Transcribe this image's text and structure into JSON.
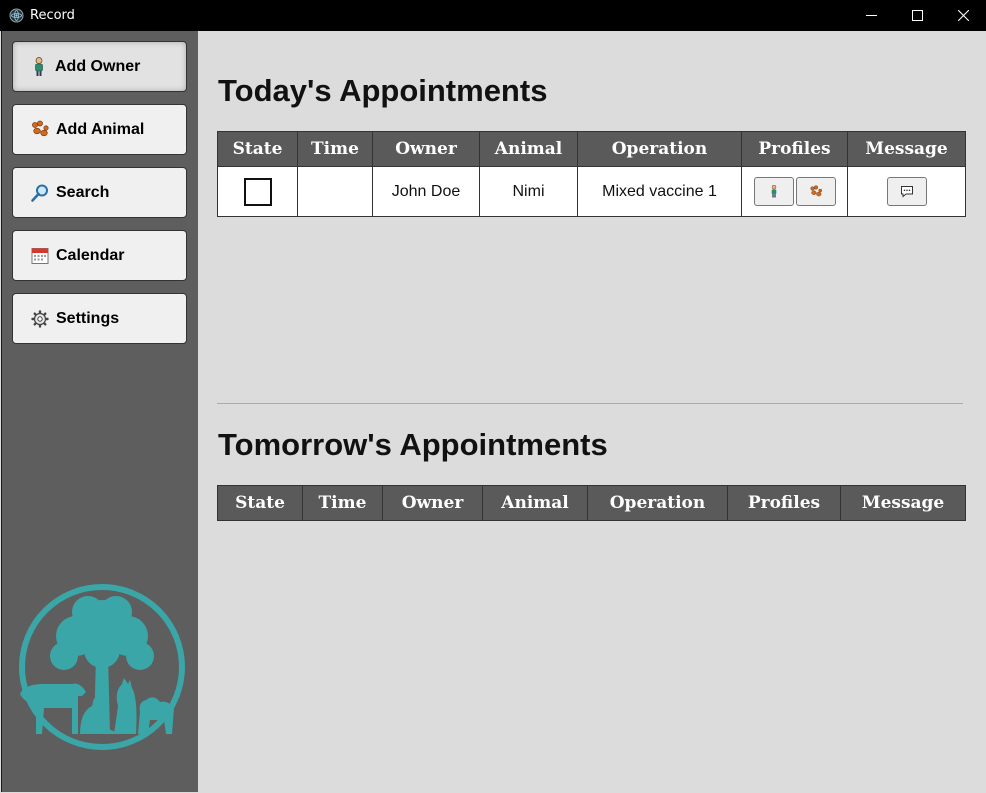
{
  "window": {
    "title": "Record"
  },
  "sidebar": {
    "items": [
      {
        "label": "Add Owner",
        "icon": "person-icon"
      },
      {
        "label": "Add Animal",
        "icon": "paw-icon"
      },
      {
        "label": "Search",
        "icon": "magnifier-icon"
      },
      {
        "label": "Calendar",
        "icon": "calendar-icon"
      },
      {
        "label": "Settings",
        "icon": "gear-icon"
      }
    ]
  },
  "today": {
    "title": "Today's Appointments",
    "headers": [
      "State",
      "Time",
      "Owner",
      "Animal",
      "Operation",
      "Profiles",
      "Message"
    ],
    "rows": [
      {
        "state": "",
        "time": "",
        "owner": "John Doe",
        "animal": "Nimi",
        "operation": "Mixed vaccine 1"
      }
    ]
  },
  "tomorrow": {
    "title": "Tomorrow's Appointments",
    "headers": [
      "State",
      "Time",
      "Owner",
      "Animal",
      "Operation",
      "Profiles",
      "Message"
    ]
  },
  "colors": {
    "accent": "#3aa6a8",
    "sidebar": "#5e5e5e",
    "header": "#5a5a5a"
  }
}
